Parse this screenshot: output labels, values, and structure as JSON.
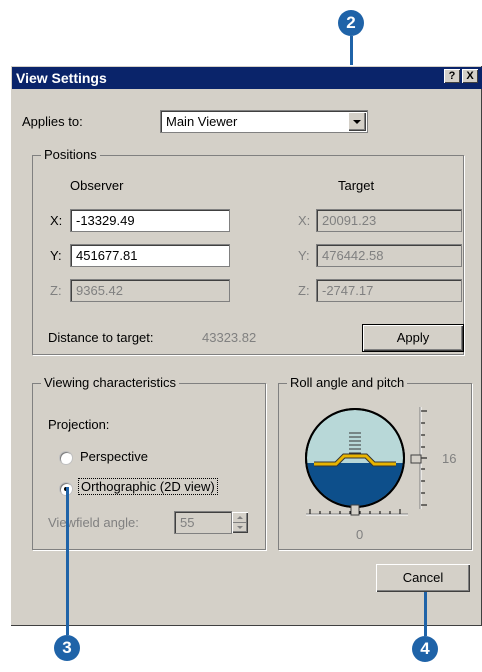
{
  "callouts": {
    "two": "2",
    "three": "3",
    "four": "4"
  },
  "window": {
    "title": "View Settings",
    "help_label": "?",
    "close_label": "X"
  },
  "applies_to": {
    "label": "Applies to:",
    "value": "Main Viewer"
  },
  "positions": {
    "legend": "Positions",
    "observer_header": "Observer",
    "target_header": "Target",
    "observer": {
      "x_label": "X:",
      "x": "-13329.49",
      "y_label": "Y:",
      "y": "451677.81",
      "z_label": "Z:",
      "z": "9365.42"
    },
    "target": {
      "x_label": "X:",
      "x": "20091.23",
      "y_label": "Y:",
      "y": "476442.58",
      "z_label": "Z:",
      "z": "-2747.17"
    },
    "distance_label": "Distance to target:",
    "distance_value": "43323.82",
    "apply_label": "Apply"
  },
  "viewing": {
    "legend": "Viewing characteristics",
    "projection_label": "Projection:",
    "options": [
      "Perspective",
      "Orthographic (2D view)"
    ],
    "selected": "Orthographic (2D view)",
    "viewfield_label": "Viewfield angle:",
    "viewfield_value": "55"
  },
  "roll": {
    "legend": "Roll angle and pitch",
    "pitch_value": "16",
    "roll_value": "0",
    "colors": {
      "sky": "#b8d8d8",
      "ground": "#0d4f8b",
      "horizon": "#e8b400"
    }
  },
  "cancel_label": "Cancel",
  "accent": "#1f63a8"
}
